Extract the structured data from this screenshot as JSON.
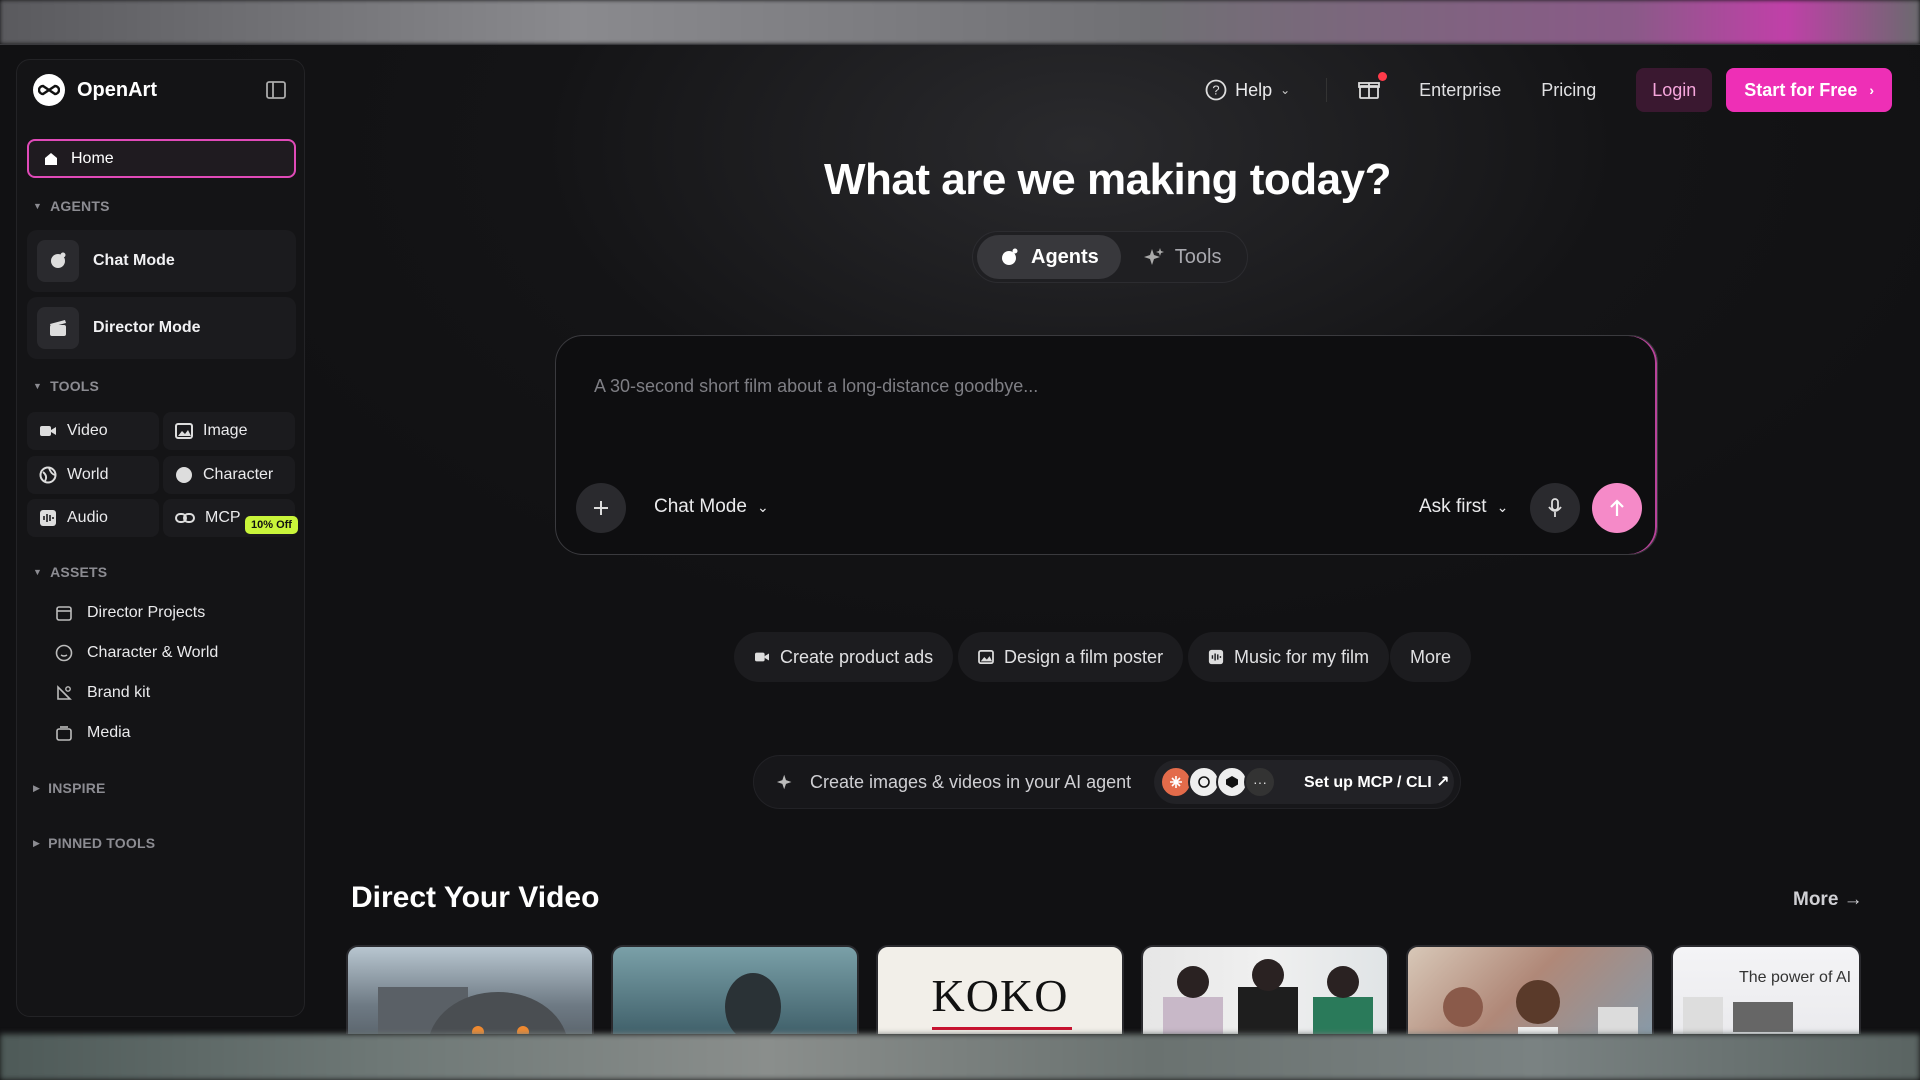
{
  "brand": {
    "name": "OpenArt"
  },
  "sidebar": {
    "home_label": "Home",
    "sections": {
      "agents": "AGENTS",
      "tools": "TOOLS",
      "assets": "ASSETS",
      "inspire": "INSPIRE",
      "pinned": "PINNED TOOLS"
    },
    "agents": [
      {
        "label": "Chat Mode",
        "icon": "agent-chat-icon"
      },
      {
        "label": "Director Mode",
        "icon": "clapperboard-icon"
      }
    ],
    "tools": [
      {
        "label": "Video",
        "icon": "video-icon"
      },
      {
        "label": "Image",
        "icon": "image-icon"
      },
      {
        "label": "World",
        "icon": "globe-icon"
      },
      {
        "label": "Character",
        "icon": "character-icon"
      },
      {
        "label": "Audio",
        "icon": "audio-icon"
      },
      {
        "label": "MCP",
        "icon": "link-icon"
      }
    ],
    "mcp_badge": "10% Off",
    "assets": [
      {
        "label": "Director Projects",
        "icon": "calendar-icon"
      },
      {
        "label": "Character & World",
        "icon": "smile-icon"
      },
      {
        "label": "Brand kit",
        "icon": "brand-icon"
      },
      {
        "label": "Media",
        "icon": "media-icon"
      }
    ]
  },
  "topnav": {
    "help": "Help",
    "enterprise": "Enterprise",
    "pricing": "Pricing",
    "login": "Login",
    "start": "Start for Free"
  },
  "hero": {
    "title": "What are we making today?",
    "tabs": [
      {
        "label": "Agents",
        "active": true
      },
      {
        "label": "Tools",
        "active": false
      }
    ]
  },
  "prompt": {
    "placeholder": "A 30-second short film about a long-distance goodbye...",
    "mode": "Chat Mode",
    "ask": "Ask first"
  },
  "chips": [
    {
      "label": "Create product ads",
      "icon": "video-icon"
    },
    {
      "label": "Design a film poster",
      "icon": "image-icon"
    },
    {
      "label": "Music for my film",
      "icon": "audio-icon"
    },
    {
      "label": "More",
      "icon": ""
    }
  ],
  "mcp": {
    "text": "Create images & videos in your AI agent",
    "link": "Set up MCP / CLI ↗"
  },
  "gallery": {
    "title": "Direct Your Video",
    "more": "More →",
    "thumbs": [
      {
        "label": ""
      },
      {
        "label": ""
      },
      {
        "label": "KOKO"
      },
      {
        "label": ""
      },
      {
        "label": ""
      },
      {
        "label": "The power of AI"
      }
    ]
  },
  "colors": {
    "accent": "#ee2fb6",
    "badge": "#c9f53a",
    "background": "#141416"
  }
}
